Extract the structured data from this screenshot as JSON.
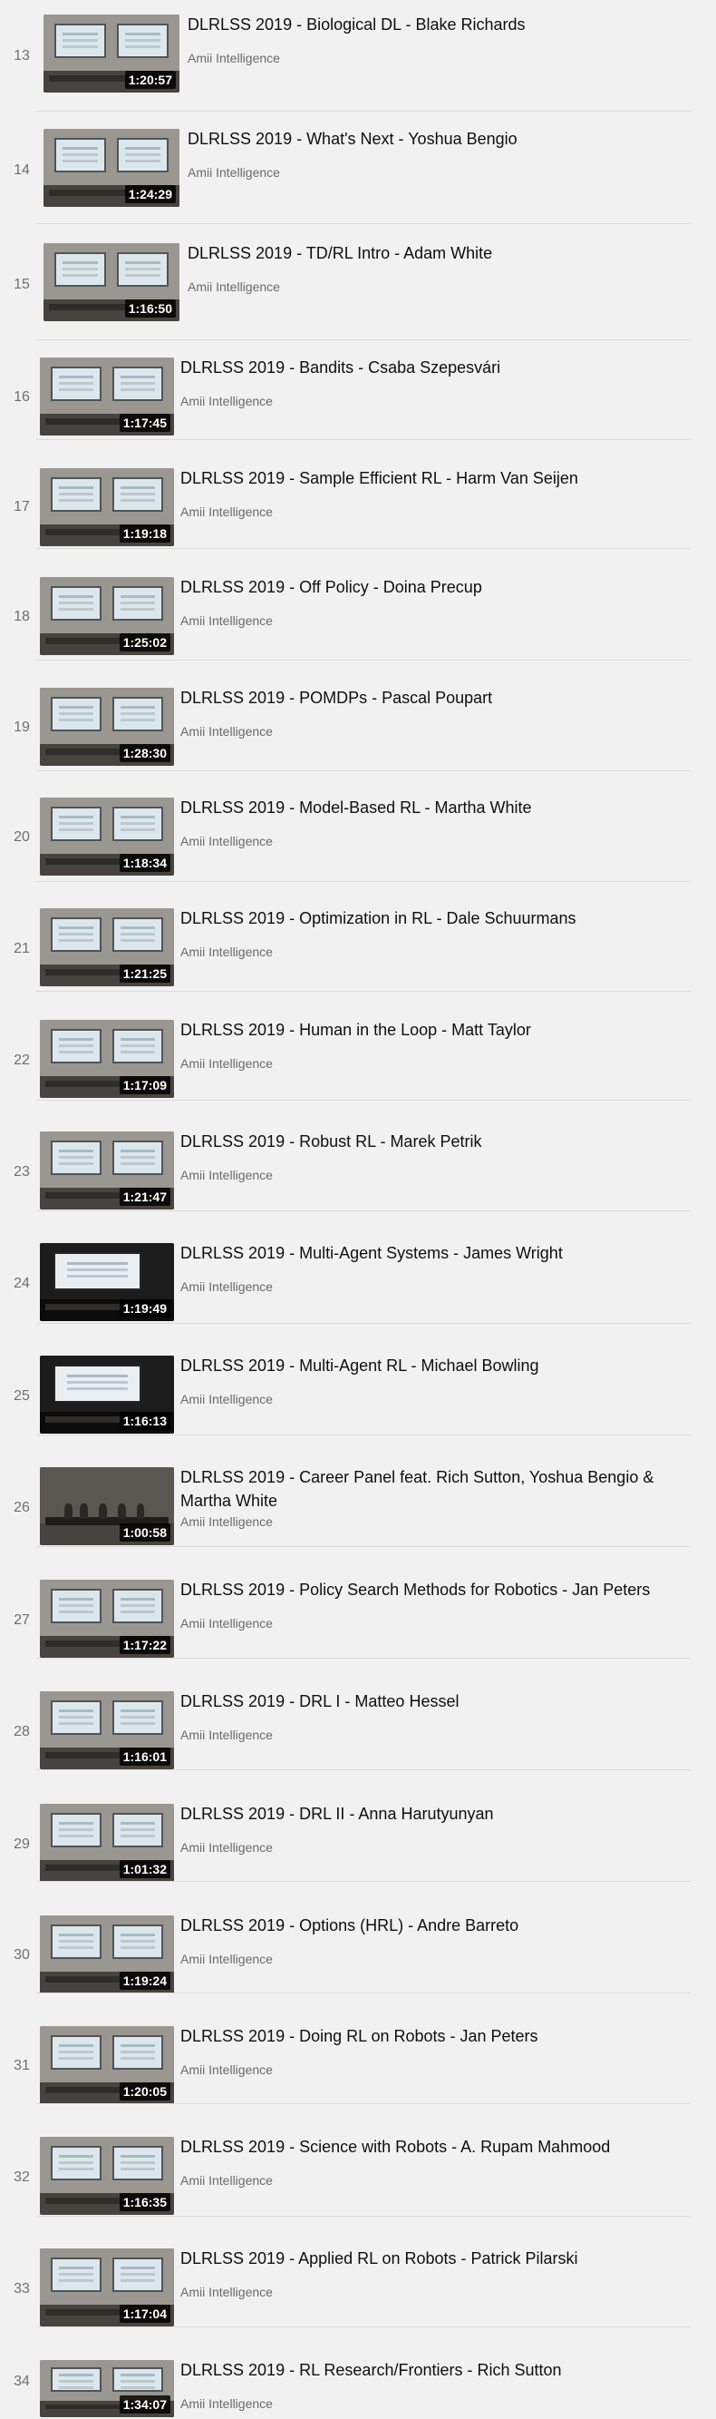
{
  "playlist": {
    "items": [
      {
        "index": "13",
        "title": "DLRLSS 2019 - Biological DL - Blake Richards",
        "channel": "Amii Intelligence",
        "duration": "1:20:57"
      },
      {
        "index": "14",
        "title": "DLRLSS 2019 - What's Next - Yoshua Bengio",
        "channel": "Amii Intelligence",
        "duration": "1:24:29"
      },
      {
        "index": "15",
        "title": "DLRLSS 2019 - TD/RL Intro - Adam White",
        "channel": "Amii Intelligence",
        "duration": "1:16:50"
      },
      {
        "index": "16",
        "title": "DLRLSS 2019 - Bandits - Csaba Szepesvári",
        "channel": "Amii Intelligence",
        "duration": "1:17:45"
      },
      {
        "index": "17",
        "title": "DLRLSS 2019 - Sample Efficient RL - Harm Van Seijen",
        "channel": "Amii Intelligence",
        "duration": "1:19:18"
      },
      {
        "index": "18",
        "title": "DLRLSS 2019 - Off Policy - Doina Precup",
        "channel": "Amii Intelligence",
        "duration": "1:25:02"
      },
      {
        "index": "19",
        "title": "DLRLSS 2019 - POMDPs - Pascal Poupart",
        "channel": "Amii Intelligence",
        "duration": "1:28:30"
      },
      {
        "index": "20",
        "title": "DLRLSS 2019 - Model-Based RL - Martha White",
        "channel": "Amii Intelligence",
        "duration": "1:18:34"
      },
      {
        "index": "21",
        "title": "DLRLSS 2019 - Optimization in RL - Dale Schuurmans",
        "channel": "Amii Intelligence",
        "duration": "1:21:25"
      },
      {
        "index": "22",
        "title": "DLRLSS 2019 - Human in the Loop - Matt Taylor",
        "channel": "Amii Intelligence",
        "duration": "1:17:09"
      },
      {
        "index": "23",
        "title": "DLRLSS 2019 - Robust RL - Marek Petrik",
        "channel": "Amii Intelligence",
        "duration": "1:21:47"
      },
      {
        "index": "24",
        "title": "DLRLSS 2019 - Multi-Agent Systems - James Wright",
        "channel": "Amii Intelligence",
        "duration": "1:19:49"
      },
      {
        "index": "25",
        "title": "DLRLSS 2019 - Multi-Agent RL - Michael Bowling",
        "channel": "Amii Intelligence",
        "duration": "1:16:13"
      },
      {
        "index": "26",
        "title": "DLRLSS 2019 - Career Panel feat. Rich Sutton, Yoshua Bengio & Martha White",
        "channel": "Amii Intelligence",
        "duration": "1:00:58"
      },
      {
        "index": "27",
        "title": "DLRLSS 2019 - Policy Search Methods for Robotics - Jan Peters",
        "channel": "Amii Intelligence",
        "duration": "1:17:22"
      },
      {
        "index": "28",
        "title": "DLRLSS 2019 - DRL I - Matteo Hessel",
        "channel": "Amii Intelligence",
        "duration": "1:16:01"
      },
      {
        "index": "29",
        "title": "DLRLSS 2019 - DRL II - Anna Harutyunyan",
        "channel": "Amii Intelligence",
        "duration": "1:01:32"
      },
      {
        "index": "30",
        "title": "DLRLSS 2019 - Options (HRL) - Andre Barreto",
        "channel": "Amii Intelligence",
        "duration": "1:19:24"
      },
      {
        "index": "31",
        "title": "DLRLSS 2019 - Doing RL on Robots - Jan Peters",
        "channel": "Amii Intelligence",
        "duration": "1:20:05"
      },
      {
        "index": "32",
        "title": "DLRLSS 2019 - Science with Robots - A. Rupam Mahmood",
        "channel": "Amii Intelligence",
        "duration": "1:16:35"
      },
      {
        "index": "33",
        "title": "DLRLSS 2019 - Applied RL on Robots - Patrick Pilarski",
        "channel": "Amii Intelligence",
        "duration": "1:17:04"
      },
      {
        "index": "34",
        "title": "DLRLSS 2019 - RL Research/Frontiers - Rich Sutton",
        "channel": "Amii Intelligence",
        "duration": "1:34:07"
      }
    ]
  }
}
